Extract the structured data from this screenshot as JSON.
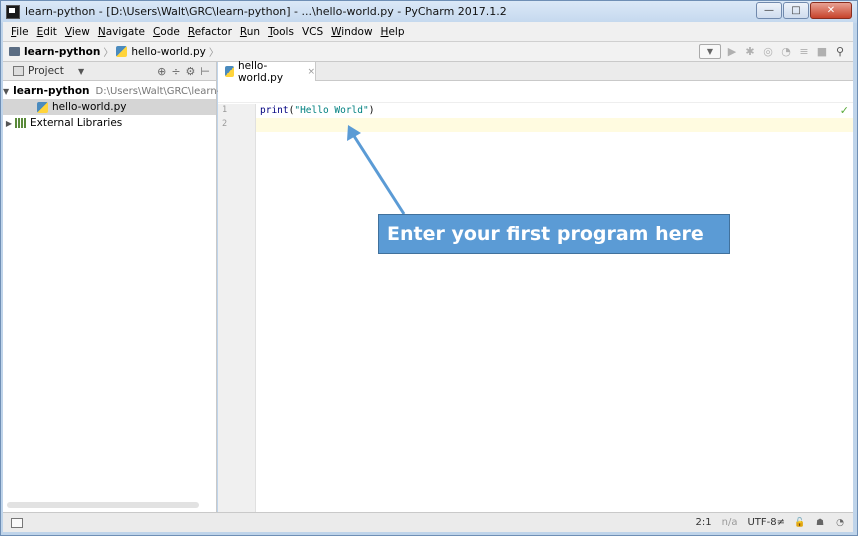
{
  "window": {
    "title": "learn-python - [D:\\Users\\Walt\\GRC\\learn-python] - ...\\hello-world.py - PyCharm 2017.1.2",
    "minimize_glyph": "—",
    "maximize_glyph": "□",
    "close_glyph": "✕"
  },
  "menu": {
    "items": [
      {
        "key": "F",
        "rest": "ile"
      },
      {
        "key": "E",
        "rest": "dit"
      },
      {
        "key": "V",
        "rest": "iew"
      },
      {
        "key": "N",
        "rest": "avigate"
      },
      {
        "key": "C",
        "rest": "ode"
      },
      {
        "key": "R",
        "rest": "efactor"
      },
      {
        "key": "R",
        "rest": "un"
      },
      {
        "key": "T",
        "rest": "ools"
      },
      {
        "key": "",
        "rest": "VCS"
      },
      {
        "key": "W",
        "rest": "indow"
      },
      {
        "key": "H",
        "rest": "elp"
      }
    ]
  },
  "navbar": {
    "project": "learn-python",
    "file": "hello-world.py",
    "separator": "〉"
  },
  "project_panel": {
    "title": "Project",
    "root_name": "learn-python",
    "root_path": "D:\\Users\\Walt\\GRC\\learn-py",
    "file": "hello-world.py",
    "libraries": "External Libraries"
  },
  "editor": {
    "tab_label": "hello-world.py",
    "tab_close": "×",
    "lines": [
      {
        "no": "1",
        "fn": "print",
        "open": "(",
        "str": "\"Hello World\"",
        "close": ")"
      },
      {
        "no": "2"
      }
    ]
  },
  "callout": {
    "text": "Enter your first program here"
  },
  "status": {
    "position": "2:1",
    "line_sep": "n/a",
    "encoding": "UTF-8≠"
  },
  "colors": {
    "callout_fill": "#5b9bd5",
    "callout_border": "#41719c",
    "current_line": "#fffbe0"
  }
}
